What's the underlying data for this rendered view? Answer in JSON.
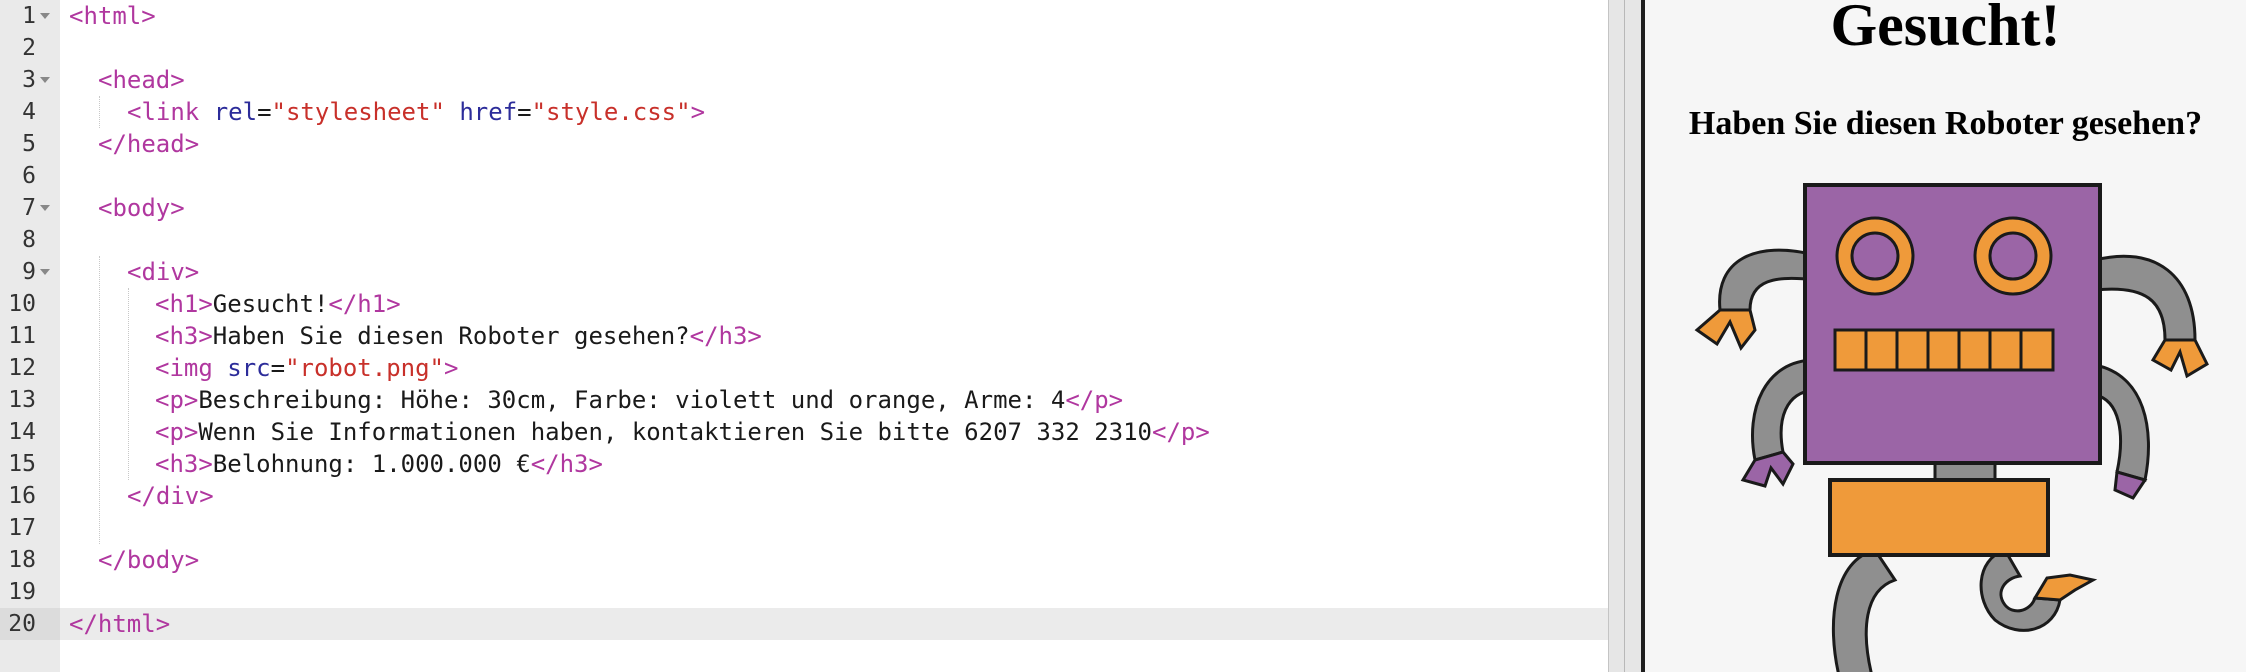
{
  "editor": {
    "lines": [
      {
        "num": "1",
        "tag_open": "<html>"
      },
      {
        "num": "2"
      },
      {
        "num": "3",
        "tag_open": "<head>"
      },
      {
        "num": "4",
        "tag_open": "<link",
        "attr1": "rel",
        "eq1": "=",
        "val1": "\"stylesheet\"",
        "attr2": "href",
        "eq2": "=",
        "val2": "\"style.css\"",
        "tag_close": ">"
      },
      {
        "num": "5",
        "tag_open": "</head>"
      },
      {
        "num": "6"
      },
      {
        "num": "7",
        "tag_open": "<body>"
      },
      {
        "num": "8"
      },
      {
        "num": "9",
        "tag_open": "<div>"
      },
      {
        "num": "10",
        "tag_open": "<h1>",
        "text": "Gesucht!",
        "tag_close": "</h1>"
      },
      {
        "num": "11",
        "tag_open": "<h3>",
        "text": "Haben Sie diesen Roboter gesehen?",
        "tag_close": "</h3>"
      },
      {
        "num": "12",
        "tag_open": "<img",
        "attr1": "src",
        "eq1": "=",
        "val1": "\"robot.png\"",
        "tag_close": ">"
      },
      {
        "num": "13",
        "tag_open": "<p>",
        "text": "Beschreibung: Höhe: 30cm, Farbe: violett und orange, Arme: 4",
        "tag_close": "</p>"
      },
      {
        "num": "14",
        "tag_open": "<p>",
        "text": "Wenn Sie Informationen haben, kontaktieren Sie bitte 6207 332 2310",
        "tag_close": "</p>"
      },
      {
        "num": "15",
        "tag_open": "<h3>",
        "text": "Belohnung: 1.000.000 €",
        "tag_close": "</h3>"
      },
      {
        "num": "16",
        "tag_open": "</div>"
      },
      {
        "num": "17"
      },
      {
        "num": "18",
        "tag_open": "</body>"
      },
      {
        "num": "19"
      },
      {
        "num": "20",
        "tag_open": "</html>"
      }
    ]
  },
  "preview": {
    "h1": "Gesucht!",
    "h3": "Haben Sie diesen Roboter gesehen?",
    "image_name": "robot-image"
  },
  "colors": {
    "tag": "#b0379f",
    "attribute": "#2c2c9a",
    "string": "#c8302a",
    "robot_body": "#9b65a6",
    "robot_orange": "#ef9a3a",
    "robot_gray": "#8f8f8f"
  }
}
